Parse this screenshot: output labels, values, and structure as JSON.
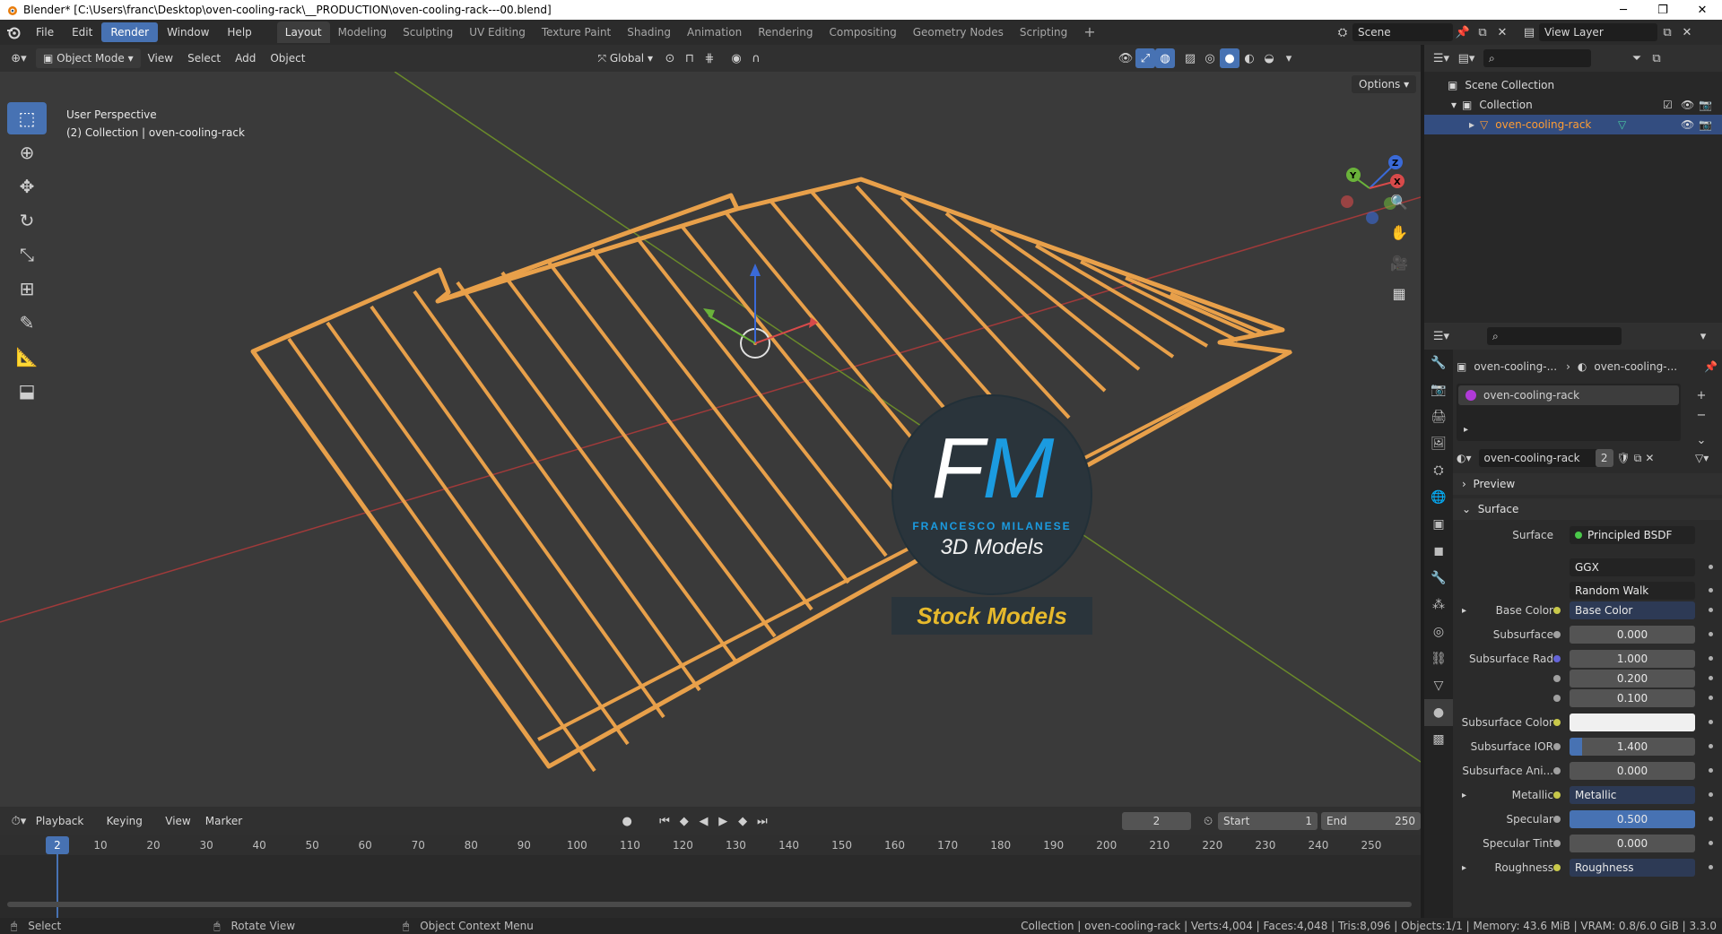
{
  "window": {
    "title": "Blender* [C:\\Users\\franc\\Desktop\\oven-cooling-rack\\__PRODUCTION\\oven-cooling-rack---00.blend]"
  },
  "menu": [
    "File",
    "Edit",
    "Render",
    "Window",
    "Help"
  ],
  "workspaces": [
    "Layout",
    "Modeling",
    "Sculpting",
    "UV Editing",
    "Texture Paint",
    "Shading",
    "Animation",
    "Rendering",
    "Compositing",
    "Geometry Nodes",
    "Scripting"
  ],
  "scene": {
    "name": "Scene",
    "view_layer": "View Layer"
  },
  "viewport_header": {
    "mode": "Object Mode",
    "menus": [
      "View",
      "Select",
      "Add",
      "Object"
    ],
    "transform": "Global",
    "options": "Options"
  },
  "viewport": {
    "info_line1": "User Perspective",
    "info_line2": "(2) Collection | oven-cooling-rack"
  },
  "watermark": {
    "letters_f": "F",
    "letters_m": "M",
    "name": "FRANCESCO MILANESE",
    "sub": "3D Models",
    "banner": "Stock Models"
  },
  "timeline": {
    "menus": [
      "Playback",
      "Keying",
      "View",
      "Marker"
    ],
    "current_frame": "2",
    "start_label": "Start",
    "start": "1",
    "end_label": "End",
    "end": "250",
    "ticks": [
      "10",
      "20",
      "30",
      "40",
      "50",
      "60",
      "70",
      "80",
      "90",
      "100",
      "110",
      "120",
      "130",
      "140",
      "150",
      "160",
      "170",
      "180",
      "190",
      "200",
      "210",
      "220",
      "230",
      "240",
      "250"
    ]
  },
  "statusbar": {
    "select": "Select",
    "rotate": "Rotate View",
    "context": "Object Context Menu",
    "stats": "Collection | oven-cooling-rack | Verts:4,004 | Faces:4,048 | Tris:8,096 | Objects:1/1 | Memory: 43.6 MiB | VRAM: 0.8/6.0 GiB | 3.3.0"
  },
  "outliner": {
    "scene_collection": "Scene Collection",
    "collection": "Collection",
    "object": "oven-cooling-rack"
  },
  "properties": {
    "breadcrumb_obj": "oven-cooling-...",
    "breadcrumb_mat": "oven-cooling-...",
    "material_slot": "oven-cooling-rack",
    "material_name": "oven-cooling-rack",
    "material_users": "2",
    "preview": "Preview",
    "surface_section": "Surface",
    "surface_label": "Surface",
    "surface_value": "Principled BSDF",
    "distribution": "GGX",
    "subsurface_method": "Random Walk",
    "rows": [
      {
        "label": "Base Color",
        "value": "Base Color",
        "type": "link"
      },
      {
        "label": "Subsurface",
        "value": "0.000",
        "type": "num"
      },
      {
        "label": "Subsurface Rad",
        "value": "1.000",
        "type": "num"
      },
      {
        "label": "",
        "value": "0.200",
        "type": "num"
      },
      {
        "label": "",
        "value": "0.100",
        "type": "num"
      },
      {
        "label": "Subsurface Color",
        "value": "",
        "type": "white"
      },
      {
        "label": "Subsurface IOR",
        "value": "1.400",
        "type": "bar",
        "fill": 0.1
      },
      {
        "label": "Subsurface Ani...",
        "value": "0.000",
        "type": "num"
      },
      {
        "label": "Metallic",
        "value": "Metallic",
        "type": "link"
      },
      {
        "label": "Specular",
        "value": "0.500",
        "type": "bar",
        "fill": 1.0
      },
      {
        "label": "Specular Tint",
        "value": "0.000",
        "type": "num"
      },
      {
        "label": "Roughness",
        "value": "Roughness",
        "type": "link"
      }
    ]
  },
  "colors": {
    "accent": "#4772b3",
    "object_orange": "#e8a04a",
    "grid_red": "#a03a3a",
    "grid_green": "#6a8a2a"
  }
}
